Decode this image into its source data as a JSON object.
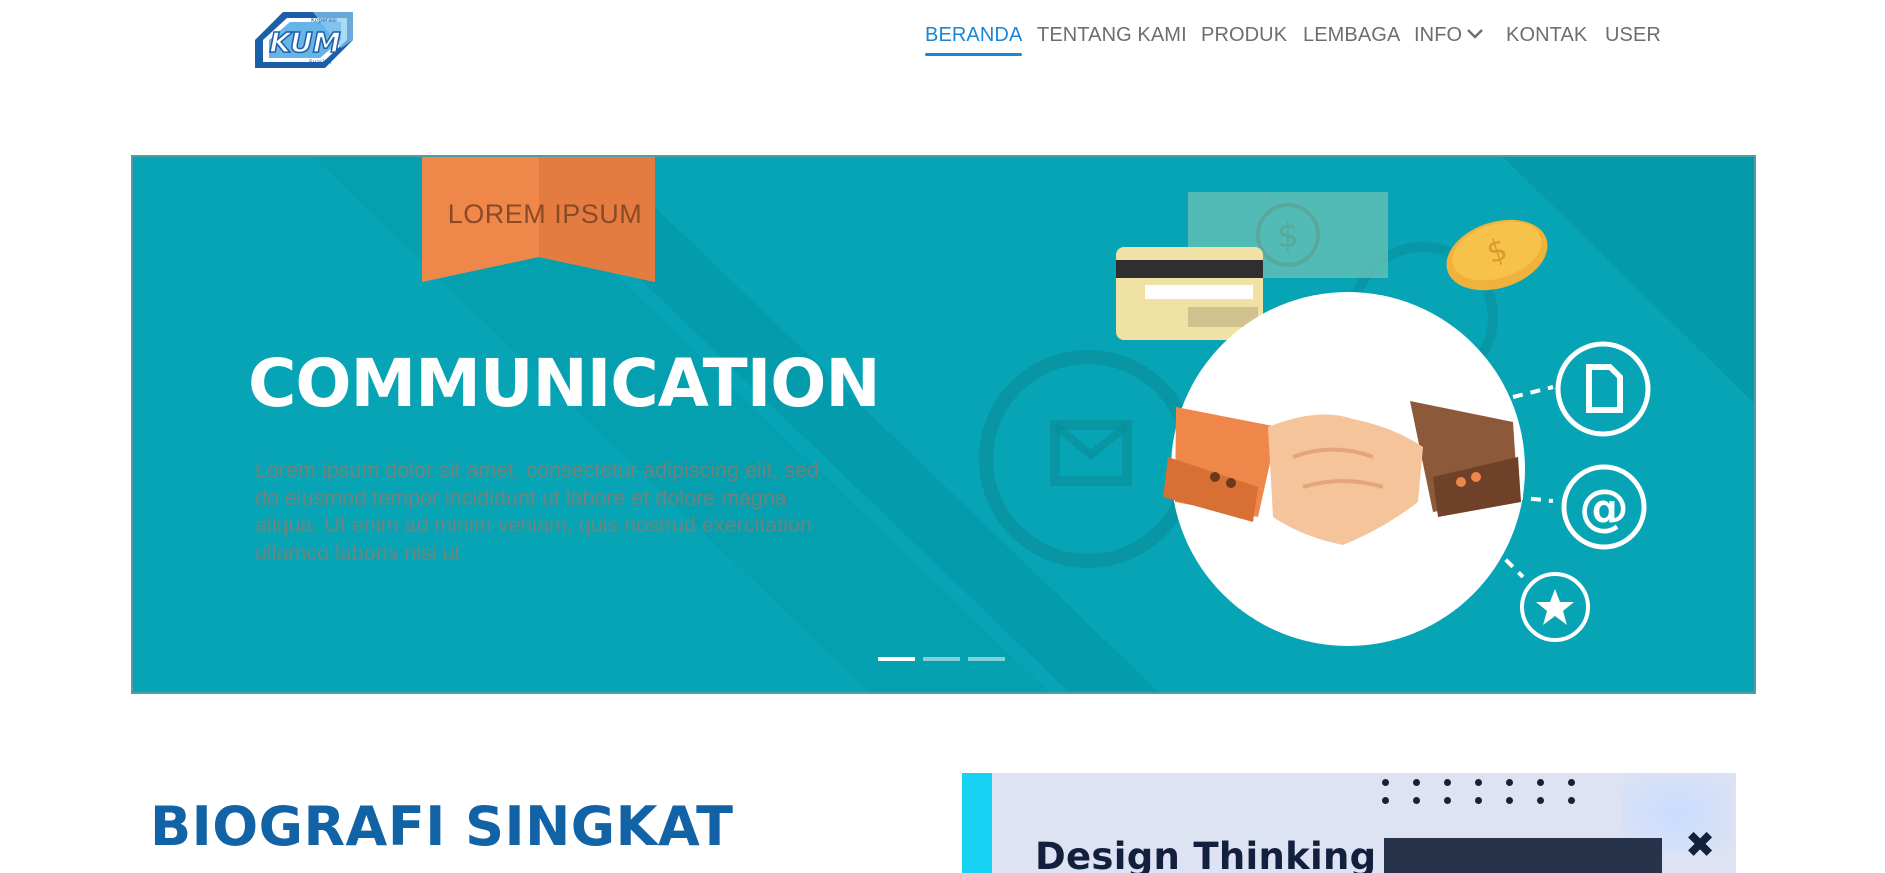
{
  "header": {
    "logo": {
      "name": "kum-logo",
      "text_top": "Koperasi",
      "text_main": "KUM",
      "text_bottom": "Syariah"
    },
    "nav": [
      {
        "label": "BERANDA",
        "active": true
      },
      {
        "label": "TENTANG KAMI",
        "active": false
      },
      {
        "label": "PRODUK",
        "active": false
      },
      {
        "label": "LEMBAGA",
        "active": false
      },
      {
        "label": "INFO",
        "active": false,
        "dropdown": true
      },
      {
        "label": "KONTAK",
        "active": false
      },
      {
        "label": "USER",
        "active": false
      }
    ],
    "icons": {
      "info_dropdown": "chevron-down-icon"
    }
  },
  "hero": {
    "ribbon": "LOREM IPSUM",
    "title": "COMMUNICATION",
    "paragraph": "Lorem ipsum dolor sit amet, consectetur adipiscing elit, sed do eiusmod tempor incididunt ut labore et dolore magna aliqua. Ut enim ad minim veniam, quis nostrud exercitation ullamco laboris nisi ut",
    "icons": [
      "money-icon",
      "credit-card-icon",
      "coin-icon",
      "mail-icon",
      "handshake-icon",
      "document-icon",
      "at-icon",
      "star-icon"
    ],
    "slides": {
      "count": 3,
      "active": 1
    },
    "colors": {
      "background": "#06a4b4",
      "ribbon": "#f0874a"
    }
  },
  "section": {
    "title": "BIOGRAFI SINGKAT"
  },
  "promo": {
    "title": "Design Thinking",
    "icons": [
      "close-icon"
    ],
    "colors": {
      "strip": "#17d2f2",
      "background": "#dde3f3"
    }
  }
}
